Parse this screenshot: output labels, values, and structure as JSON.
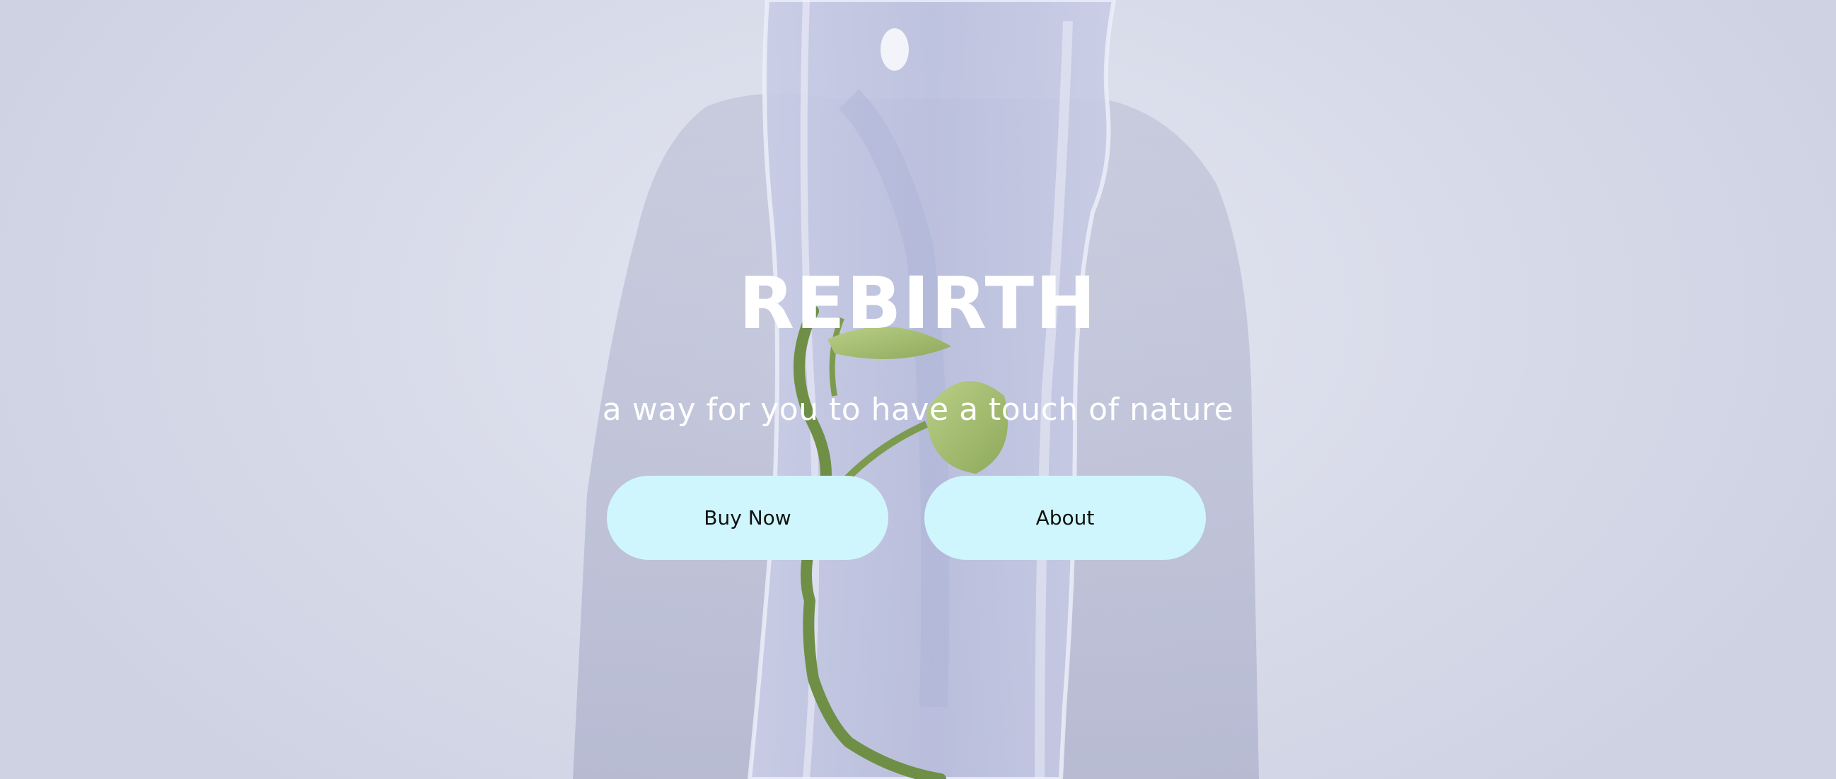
{
  "hero": {
    "title": "REBIRTH",
    "subtitle": "a way for you to have a touch of nature",
    "background_image": "plant-in-plastic-bag-photo",
    "colors": {
      "title_text": "#ffffff",
      "button_bg": "#cff6fd",
      "button_text": "#111111",
      "background": "#d9dcea"
    }
  },
  "buttons": {
    "buy_now": "Buy Now",
    "about": "About"
  }
}
